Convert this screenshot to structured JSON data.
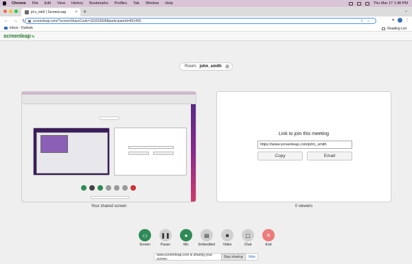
{
  "menubar": {
    "app": "Chrome",
    "items": [
      "File",
      "Edit",
      "View",
      "History",
      "Bookmarks",
      "Profiles",
      "Tab",
      "Window",
      "Help"
    ],
    "clock": "Thu Mar 17  1:48 PM"
  },
  "browser": {
    "tab_title": "jd-s_mk6 | ScreenLeap",
    "url": "screenleap.com/?screenShareCode=1033336088participantId=891455",
    "bookmark": "Inbox - Outlook",
    "reading_list": "Reading List"
  },
  "screenleap": {
    "logo": "screenleap",
    "room_label": "Room:",
    "room_name": "john_smith",
    "join_title": "Link to join this meeting",
    "join_url": "https://www.screenleap.com/john_smith",
    "copy_label": "Copy",
    "email_label": "Email",
    "left_caption": "Your shared screen",
    "right_caption": "0 viewers"
  },
  "controls": [
    {
      "label": "Screen",
      "icon": "screen-icon"
    },
    {
      "label": "Pause",
      "icon": "pause-icon"
    },
    {
      "label": "Mic",
      "icon": "mic-icon"
    },
    {
      "label": "Embedded",
      "icon": "embedded-icon"
    },
    {
      "label": "Video",
      "icon": "video-icon"
    },
    {
      "label": "Chat",
      "icon": "chat-icon"
    },
    {
      "label": "End",
      "icon": "end-icon"
    }
  ],
  "sharebar": {
    "message": "www.screenleap.com is sharing your screen.",
    "stop": "Stop sharing",
    "hide": "Hide"
  },
  "colors": {
    "accent_green": "#2e8b57",
    "end_red": "#ec7b7b"
  }
}
